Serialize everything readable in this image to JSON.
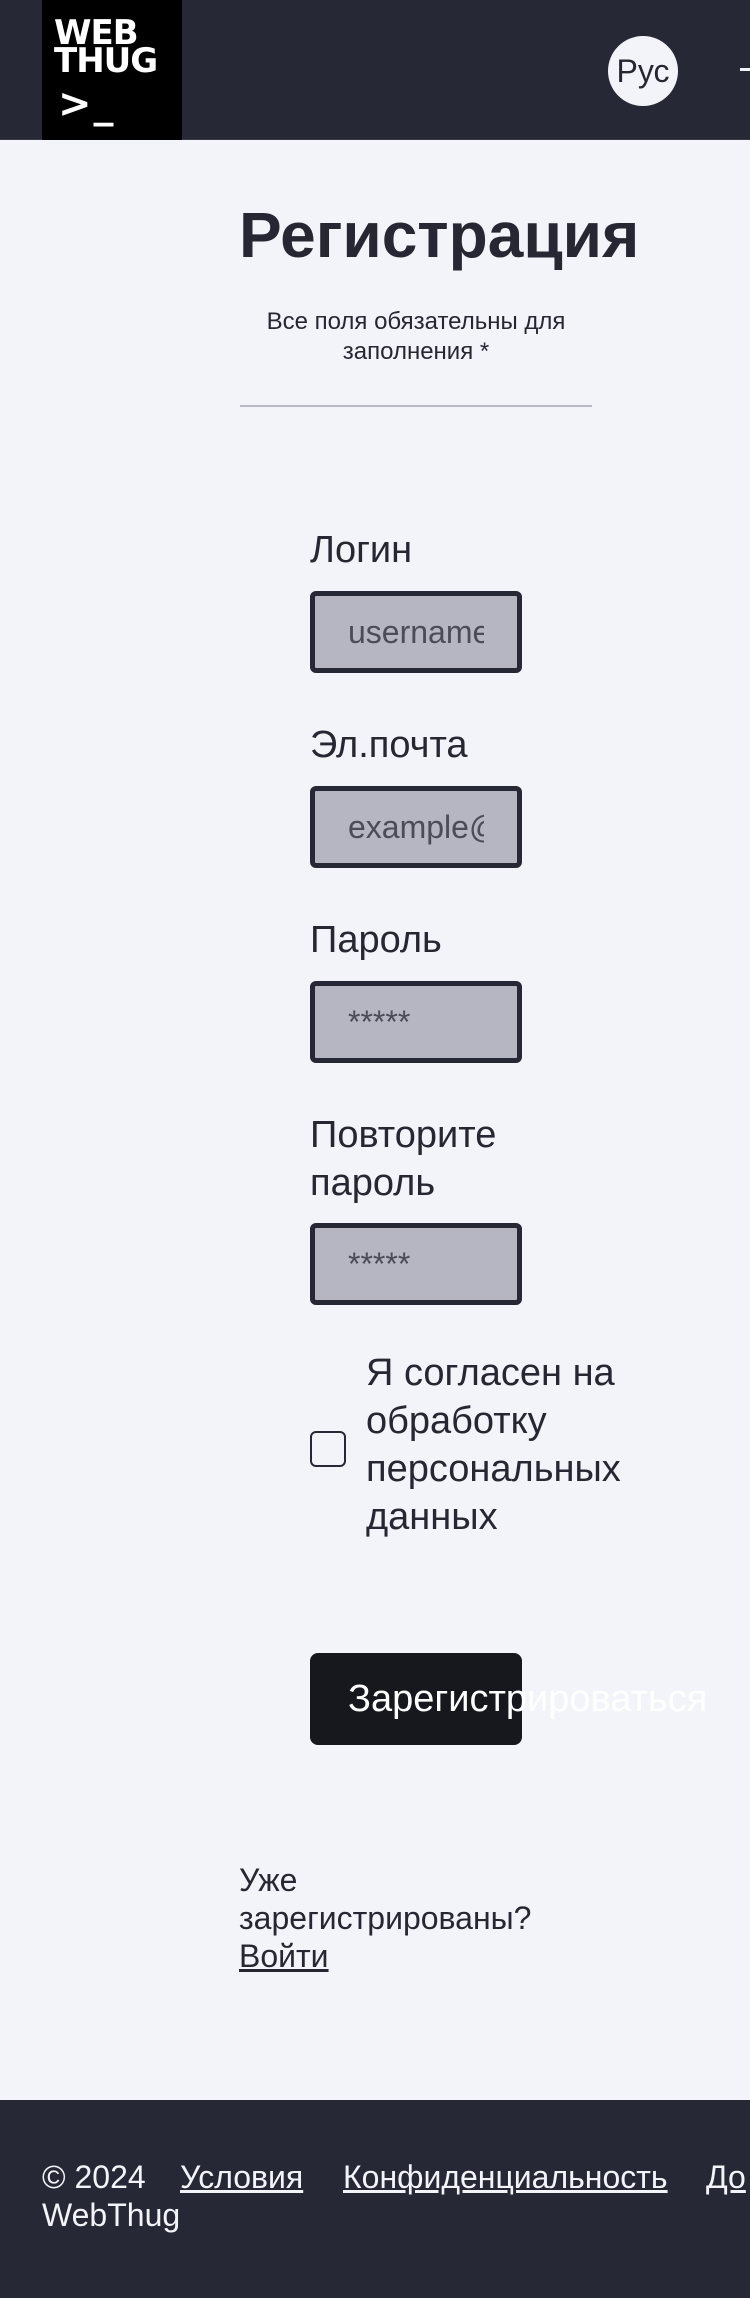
{
  "header": {
    "logo": {
      "line1": "WEB",
      "line2": "THUG",
      "line3": ">_"
    },
    "lang_button": "Рус"
  },
  "form": {
    "title": "Регистрация",
    "subtitle": "Все поля обязательны для заполнения *",
    "fields": [
      {
        "label": "Логин",
        "placeholder": "username"
      },
      {
        "label": "Эл.почта",
        "placeholder": "example@"
      },
      {
        "label": "Пароль",
        "placeholder": "*****"
      },
      {
        "label": "Повторите пароль",
        "placeholder": "*****"
      }
    ],
    "consent_label": "Я согласен на обработку персональных данных",
    "submit_label": "Зарегистрироваться",
    "login_prompt": "Уже зарегистрированы?",
    "login_link": "Войти"
  },
  "footer": {
    "copyright": "© 2024 WebThug",
    "links": [
      "Условия",
      "Конфиденциальность",
      "До"
    ]
  }
}
